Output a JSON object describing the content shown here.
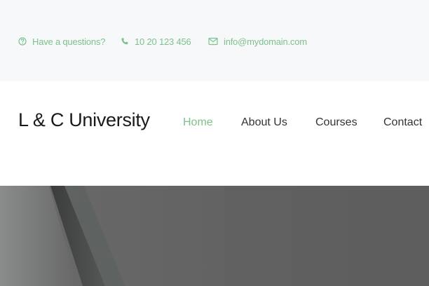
{
  "topbar": {
    "question_text": "Have a questions?",
    "phone_text": "10 20 123 456",
    "email_text": "info@mydomain.com"
  },
  "header": {
    "logo_text": "L & C University",
    "nav": [
      {
        "label": "Home",
        "active": true
      },
      {
        "label": "About Us",
        "active": false
      },
      {
        "label": "Courses",
        "active": false
      },
      {
        "label": "Contact",
        "active": false
      }
    ]
  },
  "colors": {
    "accent": "#7fc08c",
    "topbar_bg": "#f6f8fa",
    "nav_text": "#333333",
    "logo_text": "#1a1a1a",
    "hero_bg": "#5e5e5e"
  }
}
